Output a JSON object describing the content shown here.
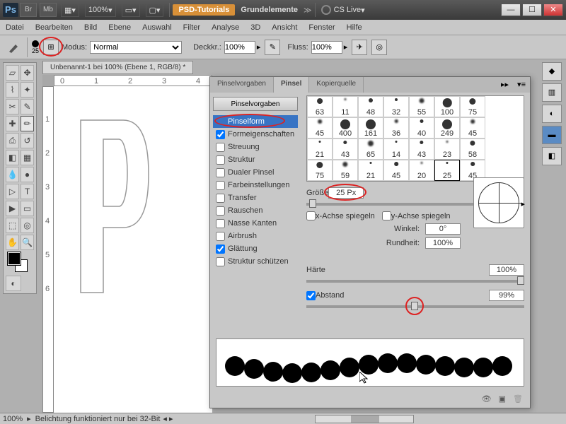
{
  "titlebar": {
    "zoom": "100%",
    "tut": "PSD-Tutorials",
    "doc": "Grundelemente",
    "cs": "CS Live"
  },
  "menu": [
    "Datei",
    "Bearbeiten",
    "Bild",
    "Ebene",
    "Auswahl",
    "Filter",
    "Analyse",
    "3D",
    "Ansicht",
    "Fenster",
    "Hilfe"
  ],
  "opt": {
    "size": "25",
    "mode_label": "Modus:",
    "mode": "Normal",
    "opacity_label": "Deckkr.:",
    "opacity": "100%",
    "flow_label": "Fluss:",
    "flow": "100%"
  },
  "docTab": "Unbenannt-1 bei 100% (Ebene 1, RGB/8) *",
  "rulerH": [
    "0",
    "1",
    "2",
    "3",
    "4"
  ],
  "rulerV": [
    "1",
    "2",
    "3",
    "4",
    "5",
    "6"
  ],
  "panel": {
    "tabs": [
      "Pinselvorgaben",
      "Pinsel",
      "Kopierquelle"
    ],
    "preset_btn": "Pinselvorgaben",
    "items": [
      {
        "label": "Pinselform",
        "sel": true,
        "chk": null
      },
      {
        "label": "Formeigenschaften",
        "chk": true
      },
      {
        "label": "Streuung",
        "chk": false
      },
      {
        "label": "Struktur",
        "chk": false
      },
      {
        "label": "Dualer Pinsel",
        "chk": false
      },
      {
        "label": "Farbeinstellungen",
        "chk": false
      },
      {
        "label": "Transfer",
        "chk": false
      },
      {
        "label": "Rauschen",
        "chk": false
      },
      {
        "label": "Nasse Kanten",
        "chk": false
      },
      {
        "label": "Airbrush",
        "chk": false
      },
      {
        "label": "Glättung",
        "chk": true
      },
      {
        "label": "Struktur schützen",
        "chk": false
      }
    ],
    "brush_sizes": [
      "63",
      "11",
      "48",
      "32",
      "55",
      "100",
      "75",
      "45",
      "400",
      "161",
      "36",
      "40",
      "249",
      "45",
      "21",
      "43",
      "65",
      "14",
      "43",
      "23",
      "58",
      "75",
      "59",
      "21",
      "45",
      "20",
      "25",
      "45"
    ],
    "size_label": "Größe",
    "size_val": "25 Px",
    "flipx": "x-Achse spiegeln",
    "flipy": "y-Achse spiegeln",
    "angle_label": "Winkel:",
    "angle": "0°",
    "round_label": "Rundheit:",
    "round": "100%",
    "hard_label": "Härte",
    "hard": "100%",
    "space_label": "Abstand",
    "space": "99%"
  },
  "status": {
    "zoom": "100%",
    "msg": "Belichtung funktioniert nur bei 32-Bit"
  }
}
